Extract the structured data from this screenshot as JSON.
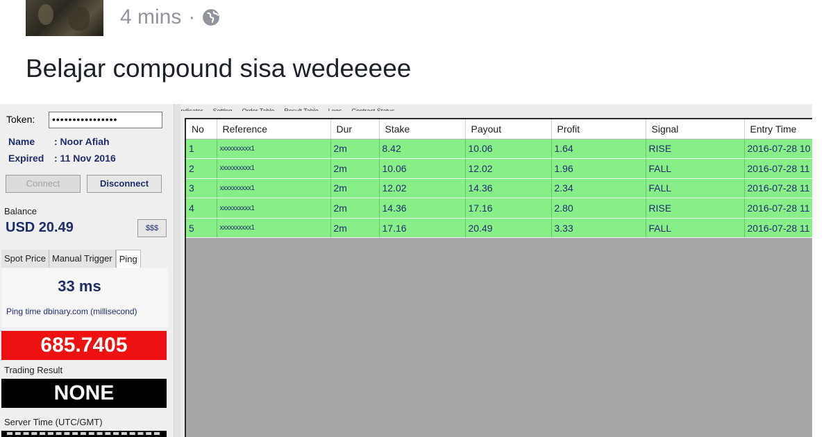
{
  "post": {
    "time": "4 mins",
    "separator": "·",
    "privacy_icon": "globe-icon",
    "text": "Belajar compound sisa wedeeeee"
  },
  "app": {
    "top_tabs": [
      "Indicator",
      "Setting",
      "Order Table",
      "Result Table",
      "Logs",
      "Contract Status"
    ],
    "token": {
      "label": "Token:",
      "value": "••••••••••••••••"
    },
    "name": {
      "label": "Name",
      "value": ": Noor Afiah"
    },
    "expired": {
      "label": "Expired",
      "value": ": 11 Nov 2016"
    },
    "connect_label": "Connect",
    "disconnect_label": "Disconnect",
    "balance": {
      "label": "Balance",
      "value": "USD 20.49",
      "button": "$$$"
    },
    "side_tabs": [
      "Spot Price",
      "Manual Trigger",
      "Ping"
    ],
    "ping": {
      "value": "33 ms",
      "desc": "Ping time dbinary.com (millisecond)"
    },
    "spot_price": "685.7405",
    "trading_result": {
      "label": "Trading Result",
      "value": "NONE"
    },
    "server_time": {
      "label": "Server Time (UTC/GMT)"
    },
    "table": {
      "columns": [
        "No",
        "Reference",
        "Dur",
        "Stake",
        "Payout",
        "Profit",
        "Signal",
        "Entry Time"
      ],
      "rows": [
        [
          "1",
          "xxxxxxxxxx1",
          "2m",
          "8.42",
          "10.06",
          "1.64",
          "RISE",
          "2016-07-28 10"
        ],
        [
          "2",
          "xxxxxxxxxx1",
          "2m",
          "10.06",
          "12.02",
          "1.96",
          "FALL",
          "2016-07-28 11"
        ],
        [
          "3",
          "xxxxxxxxxx1",
          "2m",
          "12.02",
          "14.36",
          "2.34",
          "FALL",
          "2016-07-28 11"
        ],
        [
          "4",
          "xxxxxxxxxx1",
          "2m",
          "14.36",
          "17.16",
          "2.80",
          "RISE",
          "2016-07-28 11"
        ],
        [
          "5",
          "xxxxxxxxxx1",
          "2m",
          "17.16",
          "20.49",
          "3.33",
          "FALL",
          "2016-07-28 11"
        ]
      ]
    }
  },
  "colors": {
    "row_green": "#88ee88",
    "spot_red": "#ee1111",
    "text_navy": "#1f2d6e"
  }
}
